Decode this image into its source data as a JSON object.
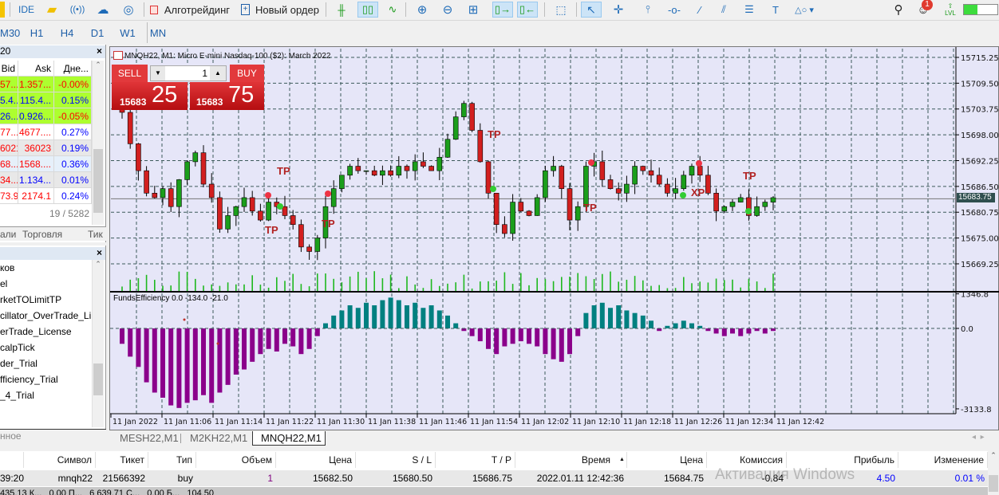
{
  "toolbar": {
    "ide": "IDE",
    "algotrading": "Алготрейдинг",
    "new_order": "Новый ордер",
    "lvl": "LVL",
    "notifications_count": "1",
    "icons": [
      "market-icon",
      "signals-icon",
      "cloud-icon",
      "vps-icon",
      "bar-chart-icon",
      "candlestick-icon",
      "line-chart-icon",
      "zoom-in-icon",
      "zoom-out-icon",
      "tile-icon",
      "autoscroll-icon",
      "chart-shift-icon",
      "screenshot-icon",
      "cursor-icon",
      "crosshair-icon",
      "vertical-line-icon",
      "horizontal-line-icon",
      "trendline-icon",
      "channel-icon",
      "fibonacci-icon",
      "text-icon",
      "shapes-icon",
      "search-icon",
      "account-icon"
    ]
  },
  "timeframes": [
    "M30",
    "H1",
    "H4",
    "D1",
    "W1",
    "MN"
  ],
  "market_watch": {
    "title": "20",
    "columns": [
      "Bid",
      "Ask",
      "Дне..."
    ],
    "rows": [
      {
        "bid": "57...",
        "ask": "1.357...",
        "change": "-0.00%",
        "bg": "#adff2f",
        "bid_color": "#ff0000",
        "ask_color": "#ff0000",
        "chg_color": "#ff0000"
      },
      {
        "bid": "5.4...",
        "ask": "115.4...",
        "change": "0.15%",
        "bg": "#adff2f",
        "bid_color": "#0000ff",
        "ask_color": "#0000ff",
        "chg_color": "#0000ff"
      },
      {
        "bid": "26...",
        "ask": "0.926...",
        "change": "-0.05%",
        "bg": "#adff2f",
        "bid_color": "#0000ff",
        "ask_color": "#0000ff",
        "chg_color": "#ff0000"
      },
      {
        "bid": "77...",
        "ask": "4677....",
        "change": "0.27%",
        "bg": "#ffffff",
        "bid_color": "#ff0000",
        "ask_color": "#ff0000",
        "chg_color": "#0000ff"
      },
      {
        "bid": "6021",
        "ask": "36023",
        "change": "0.19%",
        "bg": "#e8e8e8",
        "bid_color": "#ff0000",
        "ask_color": "#ff0000",
        "chg_color": "#0000ff"
      },
      {
        "bid": "68...",
        "ask": "1568....",
        "change": "0.36%",
        "bg": "#e6f0fa",
        "bid_color": "#ff0000",
        "ask_color": "#ff0000",
        "chg_color": "#0000ff"
      },
      {
        "bid": "34...",
        "ask": "1.134...",
        "change": "0.01%",
        "bg": "#e8e8e8",
        "bid_color": "#ff0000",
        "ask_color": "#0000ff",
        "chg_color": "#0000ff"
      },
      {
        "bid": "73.9",
        "ask": "2174.1",
        "change": "0.24%",
        "bg": "#ffffff",
        "bid_color": "#ff0000",
        "ask_color": "#ff0000",
        "chg_color": "#0000ff"
      }
    ],
    "count": "19 / 5282",
    "tabs": [
      "али",
      "Торговля",
      "Тик"
    ]
  },
  "navigator": {
    "items": [
      "ков",
      "el",
      "rketTOLimitTP",
      "cillator_OverTrade_Lic",
      "erTrade_License",
      "calpTick",
      "der_Trial",
      "fficiency_Trial",
      "_4_Trial"
    ],
    "footer": "нное"
  },
  "chart": {
    "title": "MNQH22, M1:  Micro E-mini Nasdaq-100 ($2): March 2022",
    "one_click": {
      "sell": "SELL",
      "buy": "BUY",
      "volume": "1",
      "sell_big": "15683",
      "sell_small": "25",
      "buy_big": "15683",
      "buy_small": "75"
    },
    "indicator_label": "FundsEfficiency 0.0 -134.0 -21.0",
    "current_price_label": "15683.75",
    "tabs": [
      "MESH22,M1",
      "M2KH22,M1",
      "MNQH22,M1"
    ],
    "active_tab": 2,
    "annotations": [
      "TP",
      "TP",
      "TP",
      "TP",
      "TP",
      "TP",
      "XP"
    ]
  },
  "chart_data": [
    {
      "type": "candlestick",
      "title": "MNQH22, M1",
      "ylim": [
        15665,
        15717
      ],
      "y_ticks": [
        "15715.25",
        "15709.50",
        "15703.75",
        "15698.00",
        "15692.25",
        "15686.50",
        "15680.75",
        "15675.00",
        "15669.25"
      ],
      "x_ticks": [
        "11 Jan 2022",
        "11 Jan 11:06",
        "11 Jan 11:14",
        "11 Jan 11:22",
        "11 Jan 11:30",
        "11 Jan 11:38",
        "11 Jan 11:46",
        "11 Jan 11:54",
        "11 Jan 12:02",
        "11 Jan 12:10",
        "11 Jan 12:18",
        "11 Jan 12:26",
        "11 Jan 12:34",
        "11 Jan 12:42"
      ],
      "current_price": 15683.75,
      "close": [
        15703,
        15696,
        15690,
        15685,
        15684,
        15686,
        15682,
        15688,
        15692,
        15694,
        15687,
        15684,
        15677,
        15680,
        15682,
        15684,
        15681,
        15679,
        15683,
        15682,
        15680,
        15678,
        15673,
        15672,
        15675,
        15682,
        15686,
        15689,
        15691,
        15690,
        15690,
        15689,
        15690,
        15689,
        15691,
        15690,
        15692,
        15691,
        15690,
        15693,
        15697,
        15702,
        15705,
        15699,
        15692,
        15685,
        15678,
        15676,
        15683,
        15681,
        15680,
        15684,
        15690,
        15691,
        15686,
        15679,
        15682,
        15691,
        15692,
        15688,
        15686,
        15685,
        15687,
        15691,
        15690,
        15689,
        15687,
        15685,
        15686,
        15689,
        15691,
        15689,
        15685,
        15681,
        15682,
        15683,
        15684,
        15680,
        15682,
        15683,
        15684
      ]
    },
    {
      "type": "bar",
      "title": "FundsEfficiency",
      "ylim": [
        -3133.8,
        1346.8
      ],
      "y_ticks": [
        "1346.8",
        "0.0",
        "-3133.8"
      ],
      "positive_color": "#008080",
      "negative_color": "#8b008b",
      "values": [
        -600,
        -1100,
        -1500,
        -2100,
        -2500,
        -2700,
        -3000,
        -3100,
        -2900,
        -2800,
        -2600,
        -2900,
        -2500,
        -2200,
        -1800,
        -1600,
        -1300,
        -1000,
        -800,
        -900,
        -600,
        -700,
        -1000,
        -800,
        -300,
        200,
        500,
        700,
        900,
        800,
        1000,
        900,
        1100,
        1200,
        1100,
        900,
        1000,
        800,
        900,
        700,
        500,
        200,
        -100,
        -300,
        -500,
        -800,
        -1000,
        -700,
        -600,
        -500,
        -600,
        -700,
        -1000,
        -1200,
        -1300,
        -1000,
        -300,
        600,
        900,
        1000,
        800,
        900,
        700,
        600,
        500,
        300,
        -100,
        100,
        200,
        300,
        200,
        100,
        -100,
        -200,
        -300,
        -200,
        -300,
        -200,
        -100,
        -200,
        -100
      ]
    }
  ],
  "trade_table": {
    "columns": [
      "",
      "Символ",
      "Тикет",
      "Тип",
      "Объем",
      "Цена",
      "S / L",
      "T / P",
      "Время",
      "Цена",
      "Комиссия",
      "Прибыль",
      "Изменение"
    ],
    "rows": [
      [
        "39:20",
        "mnqh22",
        "21566392",
        "buy",
        "1",
        "15682.50",
        "15680.50",
        "15686.75",
        "2022.01.11 12:42:36",
        "15684.75",
        "-0.84",
        "4.50",
        "0.01 %"
      ]
    ],
    "summary": "435.13 К...   0.00 П...   6 639.71 С...   0.00 Б...   104.50",
    "watermark": "Активация Windows"
  }
}
